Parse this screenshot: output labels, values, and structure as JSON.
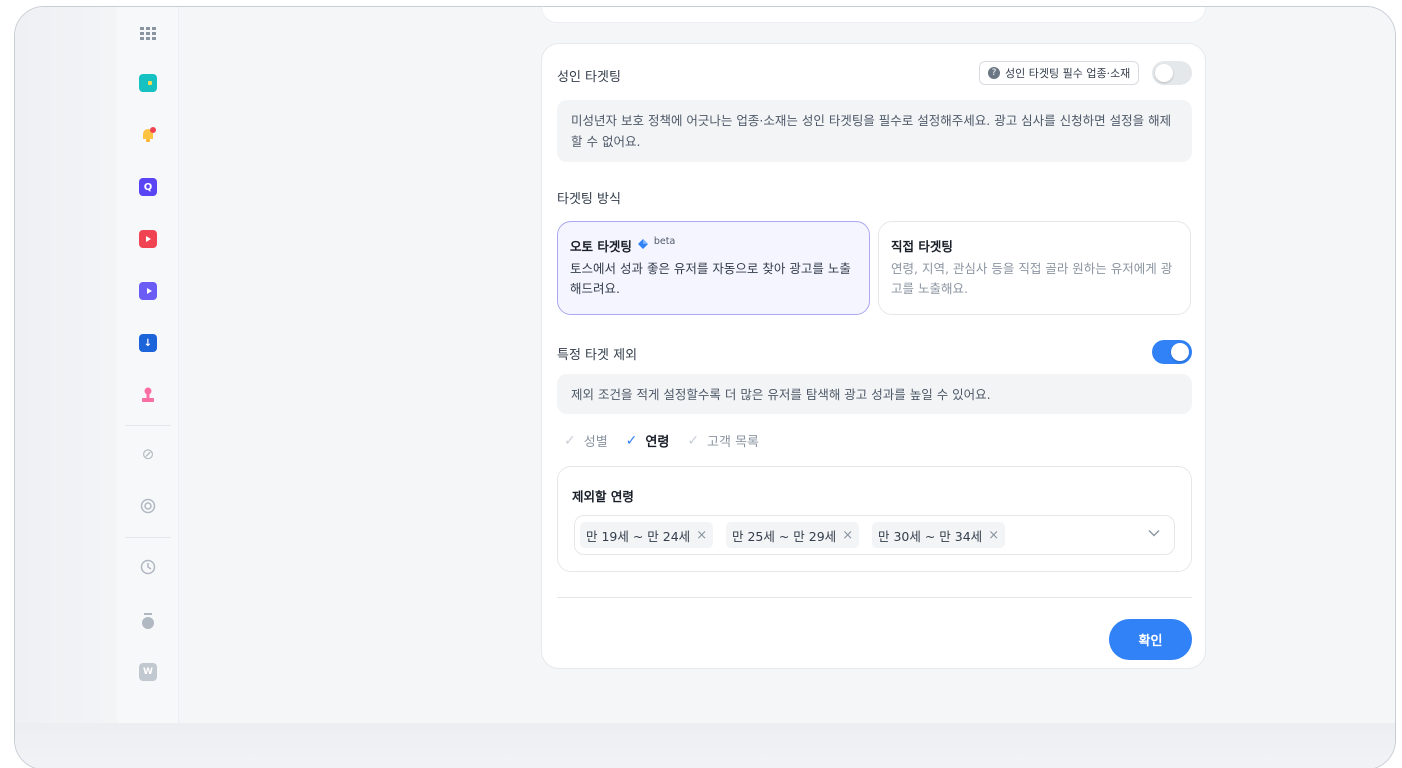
{
  "sidebar": {
    "icons": [
      {
        "name": "apps-grid-icon",
        "color": "#8b95a1"
      },
      {
        "name": "wallet-icon",
        "color": "#15c1c1"
      },
      {
        "name": "bell-icon",
        "color": "#ffc342"
      },
      {
        "name": "quiz-icon",
        "color": "#5a45f5"
      },
      {
        "name": "film-icon",
        "color": "#f04452"
      },
      {
        "name": "video-icon",
        "color": "#6b5cf6"
      },
      {
        "name": "download-icon",
        "color": "#1b64da"
      },
      {
        "name": "stamp-icon",
        "color": "#f96ea2"
      },
      {
        "name": "link-icon",
        "color": "#b0b8c1"
      },
      {
        "name": "target-icon",
        "color": "#b0b8c1"
      },
      {
        "name": "history-icon",
        "color": "#b0b8c1"
      },
      {
        "name": "money-bag-icon",
        "color": "#b0b8c1"
      },
      {
        "name": "won-icon",
        "color": "#b0b8c1"
      }
    ]
  },
  "adult": {
    "title": "성인 타겟팅",
    "help_label": "성인 타겟팅 필수 업종·소재",
    "toggle_on": false,
    "info": "미성년자 보호 정책에 어긋나는 업종·소재는 성인 타겟팅을 필수로 설정해주세요. 광고 심사를 신청하면 설정을 해제할 수 없어요."
  },
  "method": {
    "title": "타겟팅 방식",
    "auto": {
      "title": "오토 타겟팅",
      "badge": "beta",
      "desc": "토스에서 성과 좋은 유저를 자동으로 찾아 광고를 노출해드려요.",
      "selected": true
    },
    "manual": {
      "title": "직접 타겟팅",
      "desc": "연령, 지역, 관심사 등을 직접 골라 원하는 유저에게 광고를 노출해요.",
      "selected": false
    }
  },
  "exclude": {
    "title": "특정 타겟 제외",
    "toggle_on": true,
    "info": "제외 조건을 적게 설정할수록 더 많은 유저를 탐색해 광고 성과를 높일 수 있어요.",
    "options": [
      {
        "label": "성별",
        "checked": false
      },
      {
        "label": "연령",
        "checked": true
      },
      {
        "label": "고객 목록",
        "checked": false
      }
    ],
    "age_label": "제외할 연령",
    "age_chips": [
      "만 19세 ~ 만 24세",
      "만 25세 ~ 만 29세",
      "만 30세 ~ 만 34세"
    ]
  },
  "confirm_label": "확인",
  "colors": {
    "primary": "#3182f6",
    "selected_border": "#a9a8f0"
  }
}
